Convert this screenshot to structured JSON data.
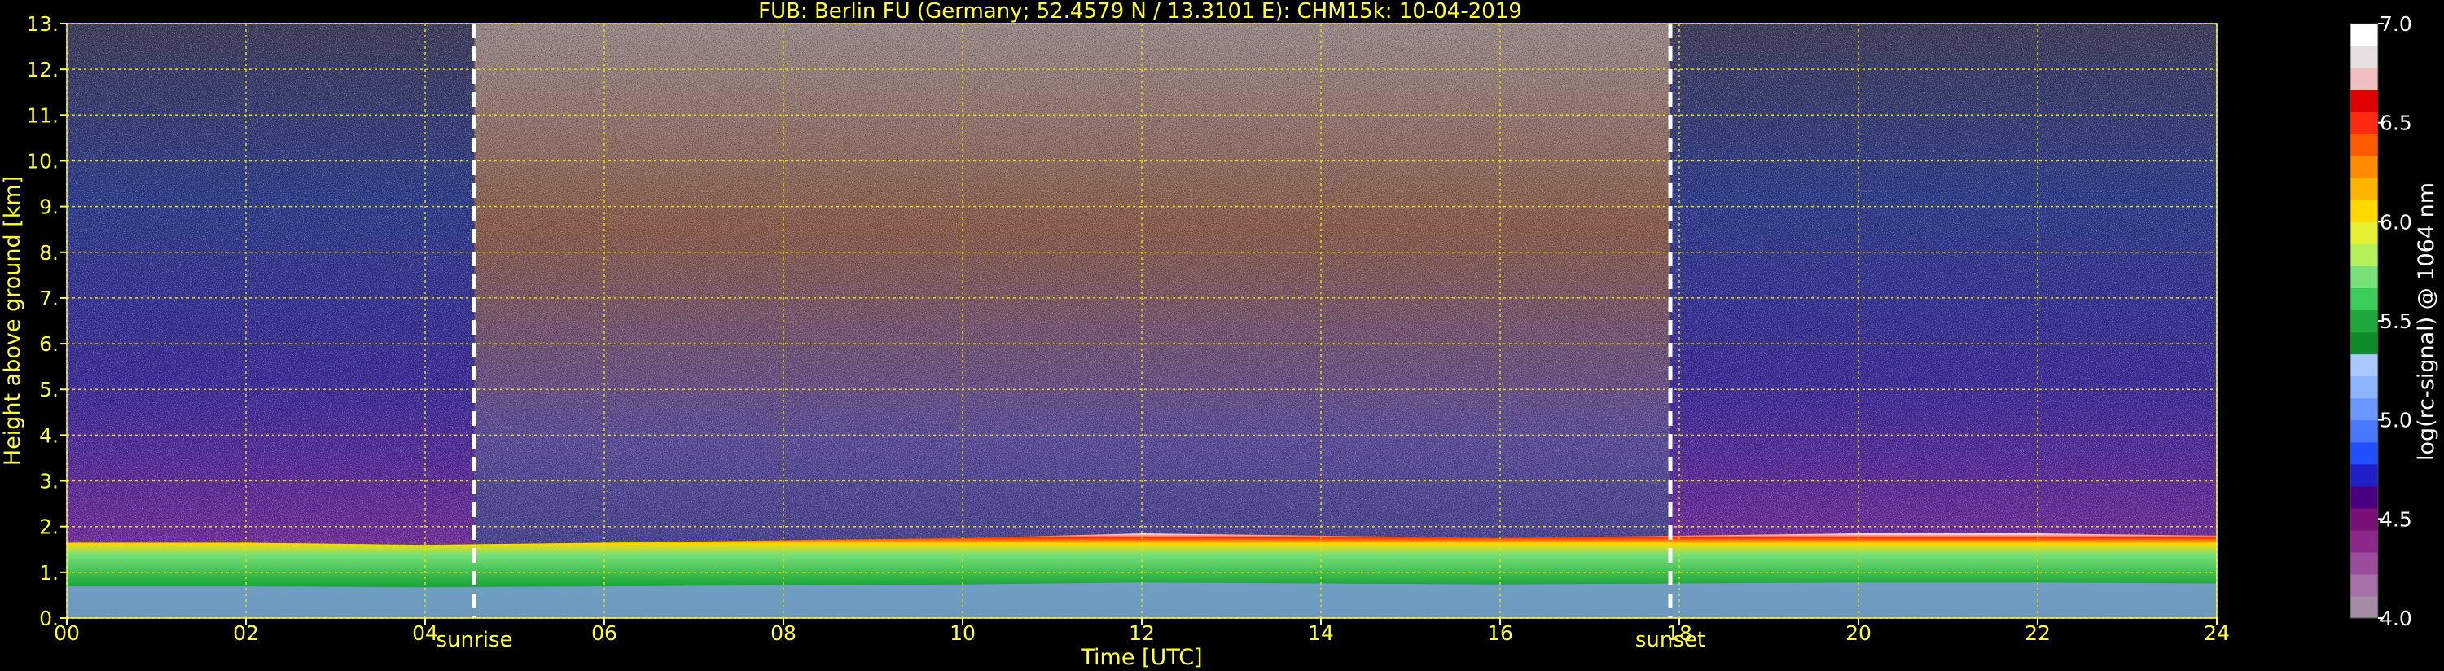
{
  "chart_data": {
    "type": "heatmap",
    "title": "FUB: Berlin FU (Germany; 52.4579 N / 13.3101 E):    CHM15k: 10-04-2019",
    "xlabel": "Time [UTC]",
    "ylabel": "Height above ground [km]",
    "xlim": [
      0,
      24
    ],
    "ylim": [
      0,
      13
    ],
    "x_ticks": [
      "00",
      "02",
      "04",
      "06",
      "08",
      "10",
      "12",
      "14",
      "16",
      "18",
      "20",
      "22",
      "24"
    ],
    "y_ticks": [
      "0.",
      "1.",
      "2.",
      "3.",
      "4.",
      "5.",
      "6.",
      "7.",
      "8.",
      "9.",
      "10.",
      "11.",
      "12.",
      "13."
    ],
    "grid": true,
    "events": [
      {
        "label": "sunrise",
        "time": 4.55
      },
      {
        "label": "sunset",
        "time": 17.9
      }
    ],
    "boundary_layer_top_km": [
      {
        "t": 0,
        "h": 1.65
      },
      {
        "t": 2,
        "h": 1.65
      },
      {
        "t": 4,
        "h": 1.6
      },
      {
        "t": 6,
        "h": 1.65
      },
      {
        "t": 8,
        "h": 1.7
      },
      {
        "t": 10,
        "h": 1.75
      },
      {
        "t": 12,
        "h": 1.85
      },
      {
        "t": 14,
        "h": 1.8
      },
      {
        "t": 16,
        "h": 1.75
      },
      {
        "t": 18,
        "h": 1.8
      },
      {
        "t": 20,
        "h": 1.85
      },
      {
        "t": 22,
        "h": 1.85
      },
      {
        "t": 24,
        "h": 1.8
      }
    ],
    "colorbar": {
      "label": "log(rc-signal) @ 1064 nm",
      "range": [
        4.0,
        7.0
      ],
      "ticks": [
        "4.0",
        "4.5",
        "5.0",
        "5.5",
        "6.0",
        "6.5",
        "7.0"
      ],
      "colors": [
        "#a48ca4",
        "#a870a8",
        "#9c4c9c",
        "#8c288c",
        "#781078",
        "#4b0082",
        "#2020c8",
        "#2050ff",
        "#4a78ff",
        "#6a98ff",
        "#8cb4ff",
        "#a8c8ff",
        "#0e8c2a",
        "#1ea83a",
        "#3ccc5a",
        "#78e078",
        "#b4f05a",
        "#e6f032",
        "#ffd800",
        "#ffb400",
        "#ff8c00",
        "#ff5a00",
        "#ff2a10",
        "#e00000",
        "#f0c0c0",
        "#e8e0e0",
        "#ffffff"
      ]
    }
  }
}
